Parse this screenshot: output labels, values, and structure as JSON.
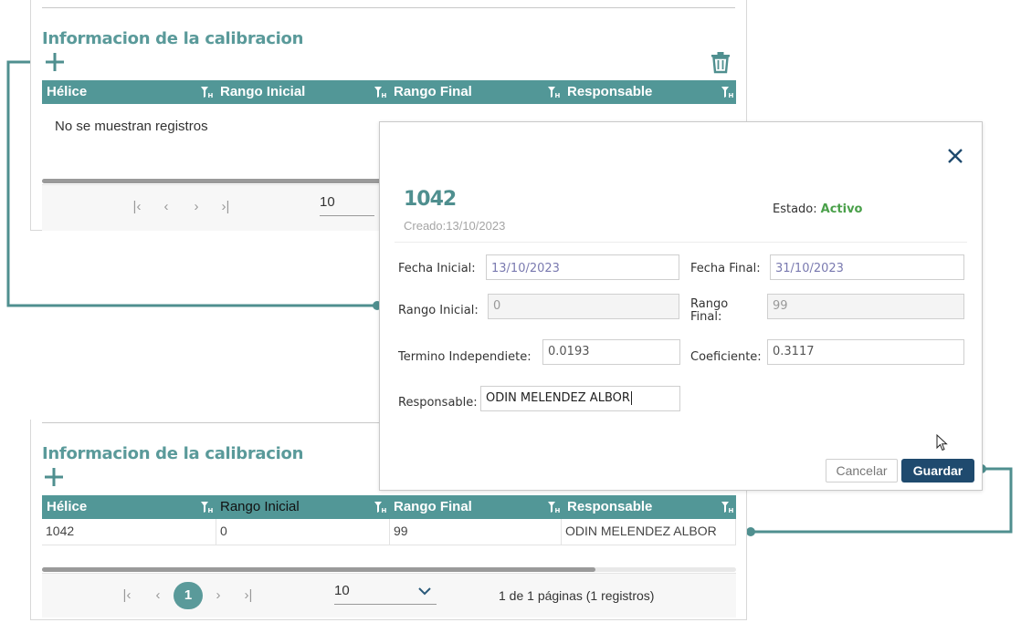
{
  "top_panel": {
    "section_title": "Informacion de la calibracion",
    "columns": [
      "Hélice",
      "Rango Inicial",
      "Rango Final",
      "Responsable"
    ],
    "empty_message": "No se muestran registros",
    "pager": {
      "page_size": "10"
    }
  },
  "modal": {
    "record_title": "1042",
    "created": "Creado:13/10/2023",
    "status_label": "Estado:",
    "status_value": "Activo",
    "fields": {
      "fecha_inicial": {
        "label": "Fecha Inicial:",
        "value": "13/10/2023"
      },
      "fecha_final": {
        "label": "Fecha Final:",
        "value": "31/10/2023"
      },
      "rango_inicial": {
        "label": "Rango Inicial:",
        "value": "0"
      },
      "rango_final": {
        "label_line1": "Rango",
        "label_line2": "Final:",
        "value": "99"
      },
      "termino": {
        "label": "Termino Independiete:",
        "value": "0.0193"
      },
      "coeficiente": {
        "label": "Coeficiente:",
        "value": "0.3117"
      },
      "responsable": {
        "label": "Responsable:",
        "value": "ODIN MELENDEZ ALBOR"
      }
    },
    "cancel_label": "Cancelar",
    "save_label": "Guardar"
  },
  "bottom_panel": {
    "section_title": "Informacion de la calibracion",
    "columns": [
      "Hélice",
      "Rango Inicial",
      "Rango Final",
      "Responsable"
    ],
    "rows": [
      {
        "helice": "1042",
        "rango_inicial": "0",
        "rango_final": "99",
        "responsable": "ODIN MELENDEZ ALBOR"
      }
    ],
    "pager": {
      "current_page": "1",
      "page_size": "10",
      "info": "1 de 1 páginas (1 registros)"
    }
  },
  "colors": {
    "accent": "#529797",
    "title": "#5a9a9a",
    "status_active": "#4aa04a",
    "save_button": "#1f4a6e"
  },
  "icons": [
    "plus-icon",
    "trash-icon",
    "filter-icon",
    "close-icon",
    "first-page-icon",
    "prev-page-icon",
    "next-page-icon",
    "last-page-icon",
    "chevron-down-icon",
    "cursor-icon"
  ]
}
